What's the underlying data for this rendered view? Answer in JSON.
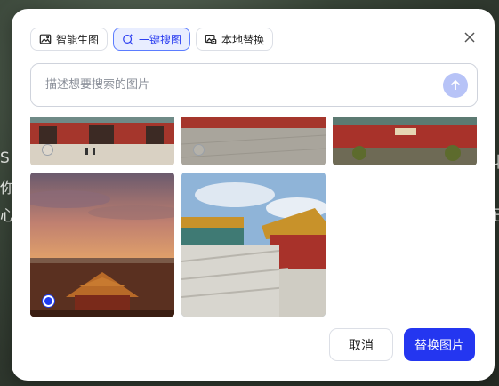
{
  "background_texts": [
    "S",
    "你",
    "心",
    "已",
    "收"
  ],
  "tabs": [
    {
      "label": "智能生图",
      "icon": "image-generate-icon",
      "active": false
    },
    {
      "label": "一键搜图",
      "icon": "sparkle-search-icon",
      "active": true
    },
    {
      "label": "本地替换",
      "icon": "local-image-icon",
      "active": false
    }
  ],
  "search": {
    "placeholder": "描述想要搜索的图片"
  },
  "footer": {
    "cancel_label": "取消",
    "confirm_label": "替换图片"
  },
  "images": [
    {
      "subject": "forbidden-city-gate-courtyard",
      "selected": false
    },
    {
      "subject": "forbidden-city-paved-square",
      "selected": false
    },
    {
      "subject": "forbidden-city-red-building",
      "selected": false
    },
    {
      "subject": "forbidden-city-sunset-skyline",
      "selected": true
    },
    {
      "subject": "forbidden-city-marble-terrace",
      "selected": false
    }
  ],
  "colors": {
    "accent": "#2436f0",
    "active_tab_bg": "#e8edff",
    "send_button": "#b7c3f7"
  }
}
